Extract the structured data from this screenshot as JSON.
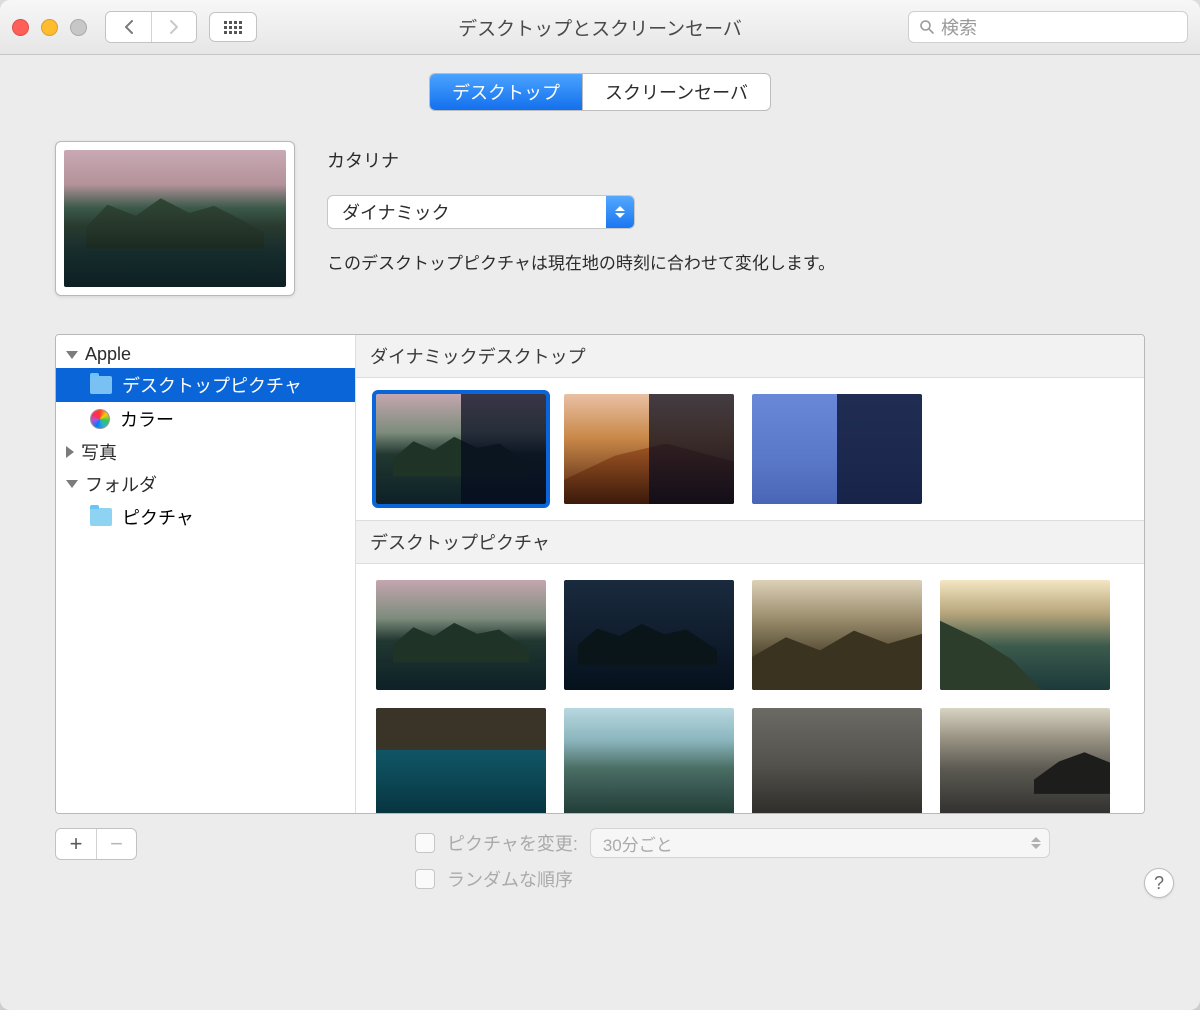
{
  "window": {
    "title": "デスクトップとスクリーンセーバ"
  },
  "search": {
    "placeholder": "検索"
  },
  "tabs": {
    "desktop": "デスクトップ",
    "screensaver": "スクリーンセーバ"
  },
  "preview": {
    "name": "カタリナ",
    "mode": "ダイナミック",
    "hint": "このデスクトップピクチャは現在地の時刻に合わせて変化します。"
  },
  "sidebar": {
    "apple": "Apple",
    "desktopPictures": "デスクトップピクチャ",
    "colors": "カラー",
    "photos": "写真",
    "folders": "フォルダ",
    "pictures": "ピクチャ"
  },
  "sections": {
    "dynamic": "ダイナミックデスクトップ",
    "pictures": "デスクトップピクチャ"
  },
  "options": {
    "changePicture": "ピクチャを変更:",
    "interval": "30分ごと",
    "random": "ランダムな順序"
  }
}
